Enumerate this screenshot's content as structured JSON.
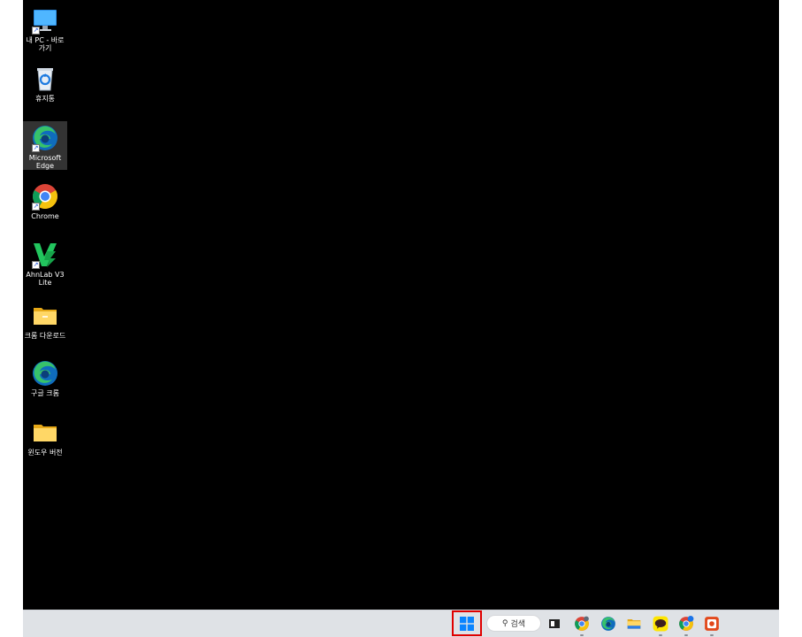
{
  "desktop": {
    "background": "#000000",
    "icons": [
      {
        "label": "내 PC - 바로 가기",
        "icon": "monitor-icon"
      },
      {
        "label": "휴지통",
        "icon": "recycle-bin-icon"
      },
      {
        "label": "Microsoft Edge",
        "icon": "edge-icon"
      },
      {
        "label": "Chrome",
        "icon": "chrome-icon"
      },
      {
        "label": "AhnLab V3 Lite",
        "icon": "v3-icon"
      },
      {
        "label": "크롬 다운로드",
        "icon": "folder-icon"
      },
      {
        "label": "구글 크롬",
        "icon": "edge-icon"
      },
      {
        "label": "윈도우 버전",
        "icon": "folder-icon"
      }
    ]
  },
  "taskbar": {
    "background": "#dfe2e6",
    "search_label": "검색",
    "apps": [
      "task-view",
      "chrome",
      "edge",
      "file-explorer",
      "kakaotalk",
      "chrome-beta",
      "app"
    ]
  }
}
